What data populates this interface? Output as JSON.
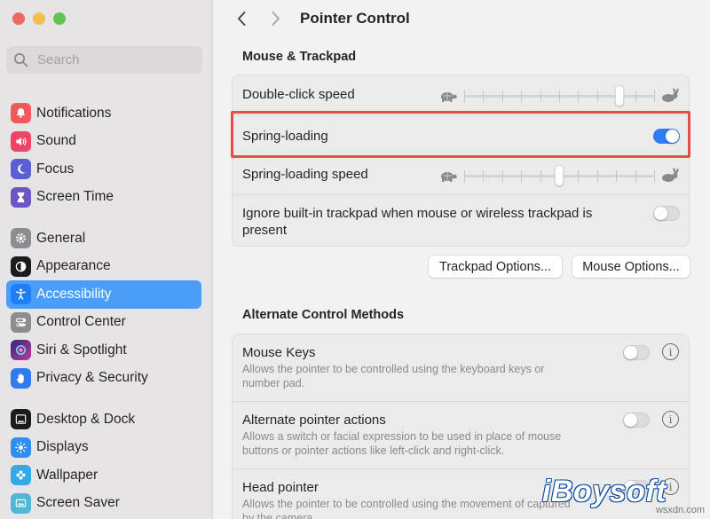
{
  "window": {
    "traffic_lights": [
      "close",
      "minimize",
      "zoom"
    ]
  },
  "search": {
    "placeholder": "Search",
    "value": ""
  },
  "sidebar": {
    "groups": [
      [
        {
          "label": "Notifications",
          "icon": "bell-icon",
          "color": "#f05a5a"
        },
        {
          "label": "Sound",
          "icon": "speaker-icon",
          "color": "#ef4466"
        },
        {
          "label": "Focus",
          "icon": "moon-icon",
          "color": "#5b5fd6"
        },
        {
          "label": "Screen Time",
          "icon": "hourglass-icon",
          "color": "#6d55c9"
        }
      ],
      [
        {
          "label": "General",
          "icon": "gear-icon",
          "color": "#8e8c91"
        },
        {
          "label": "Appearance",
          "icon": "appearance-icon",
          "color": "#1b1b1d"
        },
        {
          "label": "Accessibility",
          "icon": "accessibility-icon",
          "color": "#1f7ef5",
          "active": true
        },
        {
          "label": "Control Center",
          "icon": "toggles-icon",
          "color": "#8e8c91"
        },
        {
          "label": "Siri & Spotlight",
          "icon": "siri-icon",
          "color": "#3b3b8f"
        },
        {
          "label": "Privacy & Security",
          "icon": "hand-icon",
          "color": "#2d7cf0"
        }
      ],
      [
        {
          "label": "Desktop & Dock",
          "icon": "dock-icon",
          "color": "#1b1b1d"
        },
        {
          "label": "Displays",
          "icon": "sun-icon",
          "color": "#2f8ef2"
        },
        {
          "label": "Wallpaper",
          "icon": "flower-icon",
          "color": "#33a9e8"
        },
        {
          "label": "Screen Saver",
          "icon": "screensaver-icon",
          "color": "#4fb8d8"
        }
      ]
    ]
  },
  "header": {
    "title": "Pointer Control"
  },
  "mouse_trackpad": {
    "section_title": "Mouse & Trackpad",
    "double_click": {
      "label": "Double-click speed",
      "value": 0.82,
      "ticks": 11
    },
    "spring_loading": {
      "label": "Spring-loading",
      "enabled": true
    },
    "spring_speed": {
      "label": "Spring-loading speed",
      "value": 0.5,
      "ticks": 11
    },
    "ignore_trackpad": {
      "label": "Ignore built-in trackpad when mouse or wireless trackpad is present",
      "enabled": false
    }
  },
  "buttons": {
    "trackpad_options": "Trackpad Options...",
    "mouse_options": "Mouse Options..."
  },
  "alternate": {
    "section_title": "Alternate Control Methods",
    "mouse_keys": {
      "label": "Mouse Keys",
      "desc": "Allows the pointer to be controlled using the keyboard keys or number pad.",
      "enabled": false
    },
    "alt_pointer": {
      "label": "Alternate pointer actions",
      "desc": "Allows a switch or facial expression to be used in place of mouse buttons or pointer actions like left-click and right-click.",
      "enabled": false
    },
    "head_pointer": {
      "label": "Head pointer",
      "desc": "Allows the pointer to be controlled using the movement of captured by the camera.",
      "enabled": false
    }
  },
  "watermark": {
    "brand": "iBoysoft",
    "site": "wsxdn.com"
  },
  "colors": {
    "accent": "#2f7df6",
    "selection": "#4a9ef8",
    "highlight_box": "#e54e47"
  }
}
